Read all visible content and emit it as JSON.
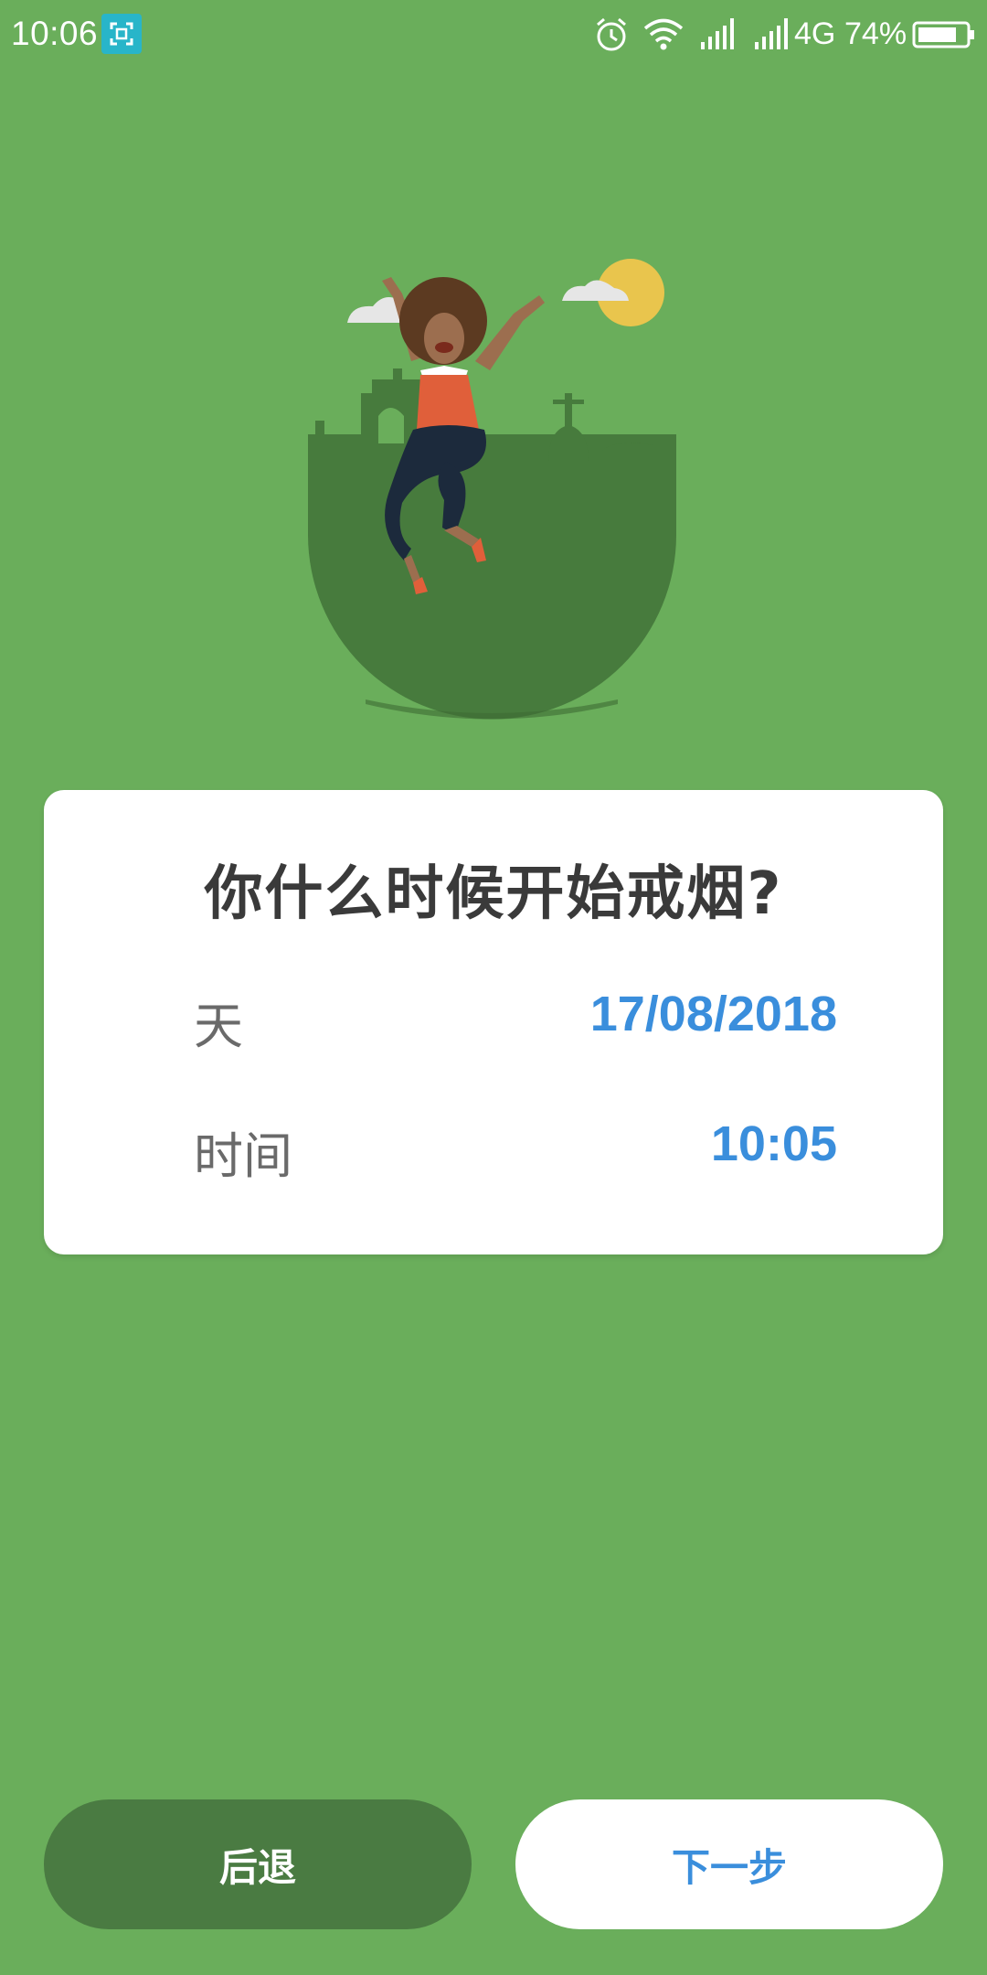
{
  "status_bar": {
    "time": "10:06",
    "network": "4G",
    "battery": "74%",
    "icons": [
      "screenshot-icon",
      "alarm-icon",
      "wifi-icon",
      "signal-icon",
      "signal-icon-2",
      "battery-icon"
    ]
  },
  "card": {
    "title": "你什么时候开始戒烟?",
    "date_label": "天",
    "date_value": "17/08/2018",
    "time_label": "时间",
    "time_value": "10:05"
  },
  "buttons": {
    "back": "后退",
    "next": "下一步"
  },
  "colors": {
    "background": "#6aae5b",
    "accent": "#3a8edc",
    "back_button": "#4a7b42"
  }
}
